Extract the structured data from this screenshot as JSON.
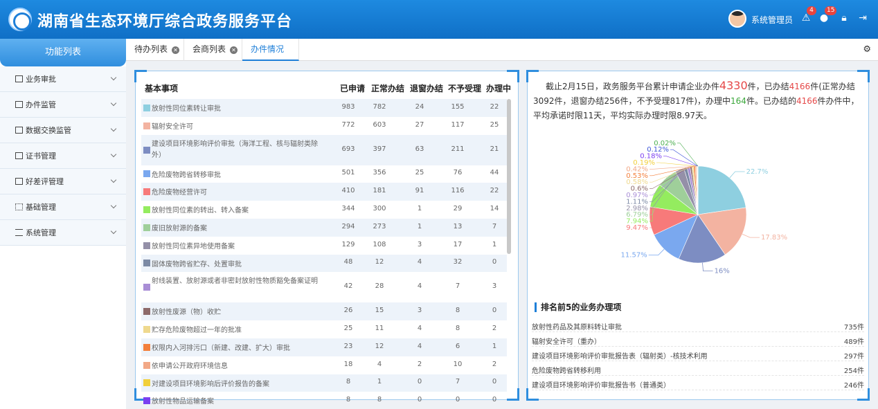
{
  "header": {
    "title": "湖南省生态环境厅综合政务服务平台",
    "user_name": "系统管理员",
    "alerts_count": "4",
    "notifications_count": "15"
  },
  "sidebar": {
    "heading": "功能列表",
    "items": [
      {
        "label": "业务审批",
        "icon": "list-icon"
      },
      {
        "label": "办件监管",
        "icon": "square-icon"
      },
      {
        "label": "数据交换监管",
        "icon": "square-icon"
      },
      {
        "label": "证书管理",
        "icon": "certificate-icon"
      },
      {
        "label": "好差评管理",
        "icon": "square-icon"
      },
      {
        "label": "基础管理",
        "icon": "grid-icon"
      },
      {
        "label": "系统管理",
        "icon": "sliders-icon"
      }
    ]
  },
  "tabs": [
    {
      "label": "待办列表",
      "closable": true
    },
    {
      "label": "会商列表",
      "closable": true
    },
    {
      "label": "办件情况",
      "closable": false,
      "active": true
    }
  ],
  "table": {
    "headers": [
      "基本事项",
      "已申请",
      "正常办结",
      "退窗办结",
      "不予受理",
      "办理中"
    ],
    "rows": [
      {
        "name": "放射性同位素转让审批",
        "color": "#8ecfe0",
        "applied": "983",
        "normal": "782",
        "returned": "24",
        "rejected": "155",
        "processing": "22"
      },
      {
        "name": "辐射安全许可",
        "color": "#f3b3a1",
        "applied": "772",
        "normal": "603",
        "returned": "27",
        "rejected": "117",
        "processing": "25"
      },
      {
        "name": "建设项目环境影响评价审批（海洋工程、核与辐射类除外）",
        "color": "#7d8dc2",
        "applied": "693",
        "normal": "397",
        "returned": "63",
        "rejected": "211",
        "processing": "21"
      },
      {
        "name": "危险废物跨省转移审批",
        "color": "#7aa8ef",
        "applied": "501",
        "normal": "356",
        "returned": "25",
        "rejected": "76",
        "processing": "44"
      },
      {
        "name": "危险废物经营许可",
        "color": "#f77a7a",
        "applied": "410",
        "normal": "181",
        "returned": "91",
        "rejected": "116",
        "processing": "22"
      },
      {
        "name": "放射性同位素的转出、转入备案",
        "color": "#94ec5f",
        "applied": "344",
        "normal": "300",
        "returned": "1",
        "rejected": "29",
        "processing": "14"
      },
      {
        "name": "废旧放射源的备案",
        "color": "#9fcf9a",
        "applied": "294",
        "normal": "273",
        "returned": "1",
        "rejected": "13",
        "processing": "7"
      },
      {
        "name": "放射性同位素异地使用备案",
        "color": "#9490a8",
        "applied": "129",
        "normal": "108",
        "returned": "3",
        "rejected": "17",
        "processing": "1"
      },
      {
        "name": "固体废物跨省贮存、处置审批",
        "color": "#7c8aa5",
        "applied": "48",
        "normal": "12",
        "returned": "4",
        "rejected": "32",
        "processing": "0"
      },
      {
        "name": "射线装置、放射源或者非密封放射性物质豁免备案证明",
        "color": "#a98ed6",
        "applied": "42",
        "normal": "28",
        "returned": "4",
        "rejected": "7",
        "processing": "3"
      },
      {
        "name": "放射性废源（物）收贮",
        "color": "#8d6a6a",
        "applied": "26",
        "normal": "15",
        "returned": "3",
        "rejected": "8",
        "processing": "0"
      },
      {
        "name": "贮存危险废物超过一年的批准",
        "color": "#efd98e",
        "applied": "25",
        "normal": "11",
        "returned": "4",
        "rejected": "8",
        "processing": "2"
      },
      {
        "name": "权限内入河排污口（新建、改建、扩大）审批",
        "color": "#f37f3b",
        "applied": "23",
        "normal": "12",
        "returned": "4",
        "rejected": "6",
        "processing": "1"
      },
      {
        "name": "依申请公开政府环境信息",
        "color": "#f2a886",
        "applied": "18",
        "normal": "4",
        "returned": "2",
        "rejected": "10",
        "processing": "2"
      },
      {
        "name": "对建设项目环境影响后评价报告的备案",
        "color": "#f1cf3a",
        "applied": "8",
        "normal": "1",
        "returned": "0",
        "rejected": "7",
        "processing": "0"
      },
      {
        "name": "放射性物品运输备案",
        "color": "#7a3ff0",
        "applied": "8",
        "normal": "8",
        "returned": "0",
        "rejected": "0",
        "processing": "0"
      }
    ]
  },
  "summary": {
    "p1": "截止2月15日，政务服务平台累计申请企业办件",
    "total": "4330",
    "p2": "件，已办结",
    "done": "4166",
    "p3": "件(正常办结3092件，退窗办结256件，不予受理817件)，办理中",
    "processing": "164",
    "p4": "件。已办结的",
    "done2": "4166",
    "p5": "件办件中，平均承诺时限11天，平均实际办理时限8.97天。"
  },
  "chart_data": {
    "type": "pie",
    "slices": [
      {
        "label": "22.7%",
        "value": 22.7,
        "color": "#8ecfe0"
      },
      {
        "label": "17.83%",
        "value": 17.83,
        "color": "#f3b3a1"
      },
      {
        "label": "16%",
        "value": 16,
        "color": "#7d8dc2"
      },
      {
        "label": "11.57%",
        "value": 11.57,
        "color": "#7aa8ef"
      },
      {
        "label": "9.47%",
        "value": 9.47,
        "color": "#f77a7a"
      },
      {
        "label": "7.94%",
        "value": 7.94,
        "color": "#94ec5f"
      },
      {
        "label": "6.79%",
        "value": 6.79,
        "color": "#9fcf9a"
      },
      {
        "label": "2.98%",
        "value": 2.98,
        "color": "#9490a8"
      },
      {
        "label": "1.11%",
        "value": 1.11,
        "color": "#7c8aa5"
      },
      {
        "label": "0.97%",
        "value": 0.97,
        "color": "#a98ed6"
      },
      {
        "label": "0.6%",
        "value": 0.6,
        "color": "#8d6a6a"
      },
      {
        "label": "0.58%",
        "value": 0.58,
        "color": "#efd98e"
      },
      {
        "label": "0.53%",
        "value": 0.53,
        "color": "#f37f3b"
      },
      {
        "label": "0.42%",
        "value": 0.42,
        "color": "#f2a886"
      },
      {
        "label": "0.19%",
        "value": 0.19,
        "color": "#f1cf3a"
      },
      {
        "label": "0.18%",
        "value": 0.18,
        "color": "#7a3ff0"
      },
      {
        "label": "0.12%",
        "value": 0.12,
        "color": "#3f57d8"
      },
      {
        "label": "0.02%",
        "value": 0.02,
        "color": "#4caf50"
      }
    ]
  },
  "top5": {
    "title": "排名前5的业务办理项",
    "items": [
      {
        "name": "放射性药品及其原料转让审批",
        "count": "735件"
      },
      {
        "name": "辐射安全许可（重办）",
        "count": "489件"
      },
      {
        "name": "建设项目环境影响评价审批报告表（辐射类）-核技术利用",
        "count": "297件"
      },
      {
        "name": "危险废物跨省转移利用",
        "count": "254件"
      },
      {
        "name": "建设项目环境影响评价审批报告书（普通类）",
        "count": "246件"
      }
    ]
  }
}
